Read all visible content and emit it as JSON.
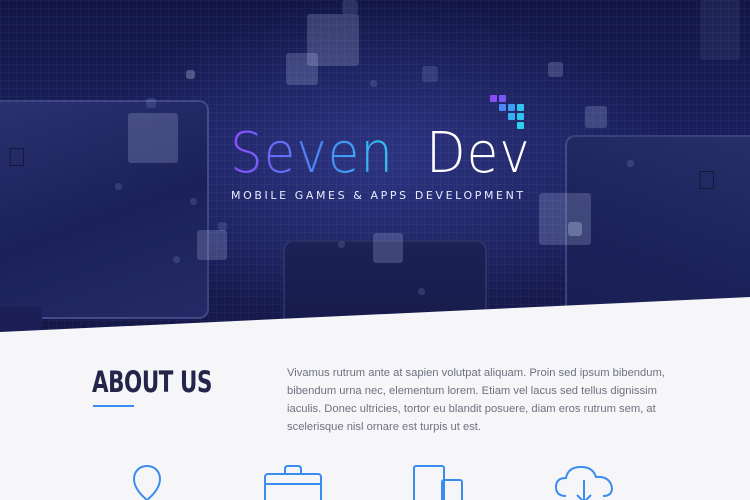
{
  "brand": {
    "name_part1": "Seven",
    "name_part2": "Dev",
    "tagline": "MOBILE GAMES & APPS DEVELOPMENT",
    "gradient": [
      "#8b4cf7",
      "#4a88f7",
      "#2ec6ee"
    ],
    "pixel_colors": [
      "#8b4cf7",
      "#6a67f6",
      "#4a88f7",
      "#2ec6ee"
    ]
  },
  "about": {
    "title": "ABOUT US",
    "body": "Vivamus rutrum ante at sapien volutpat aliquam. Proin sed ipsum bibendum, bibendum urna nec, elementum lorem. Etiam vel lacus sed tellus dignissim iaculis. Donec ultricies, tortor eu blandit posuere, diam eros rutrum sem, at scelerisque nisl ornare est turpis ut est.",
    "accent": "#3a8df0"
  },
  "features": [
    {
      "icon": "person-icon"
    },
    {
      "icon": "briefcase-icon"
    },
    {
      "icon": "devices-icon"
    },
    {
      "icon": "cloud-download-icon"
    }
  ],
  "hero": {
    "background_dark": "#121646",
    "background_mid": "#1a1f5c"
  }
}
